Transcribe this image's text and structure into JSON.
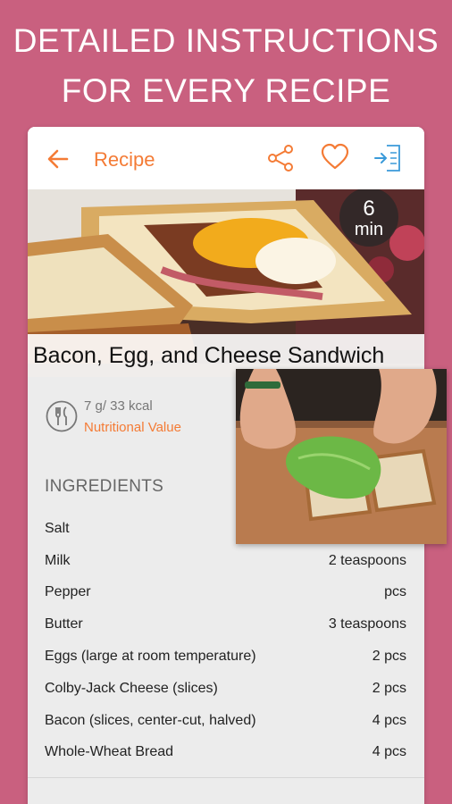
{
  "promo": {
    "line1": "DETAILED INSTRUCTIONS",
    "line2": "FOR EVERY RECIPE"
  },
  "appbar": {
    "title": "Recipe",
    "icons": [
      "arrow-back-icon",
      "share-icon",
      "heart-icon",
      "exit-to-list-icon"
    ]
  },
  "hero": {
    "timer_value": "6",
    "timer_unit": "min",
    "dish_title": "Bacon, Egg, and Cheese Sandwich"
  },
  "nutrition": {
    "value": "7 g/ 33 kcal",
    "label": "Nutritional Value"
  },
  "ingredients": {
    "header": "INGREDIENTS",
    "items": [
      {
        "name": "Salt",
        "amount": ""
      },
      {
        "name": "Milk",
        "amount": "2 teaspoons"
      },
      {
        "name": "Pepper",
        "amount": "pcs"
      },
      {
        "name": "Butter",
        "amount": "3 teaspoons"
      },
      {
        "name": "Eggs (large at room temperature)",
        "amount": "2 pcs"
      },
      {
        "name": "Colby-Jack Cheese (slices)",
        "amount": "2 pcs"
      },
      {
        "name": "Bacon (slices, center-cut, halved)",
        "amount": "4 pcs"
      },
      {
        "name": "Whole-Wheat Bread",
        "amount": "4 pcs"
      }
    ]
  },
  "colors": {
    "background": "#c9607f",
    "accent": "#f47b35",
    "icon_blue": "#3a9ad9"
  }
}
